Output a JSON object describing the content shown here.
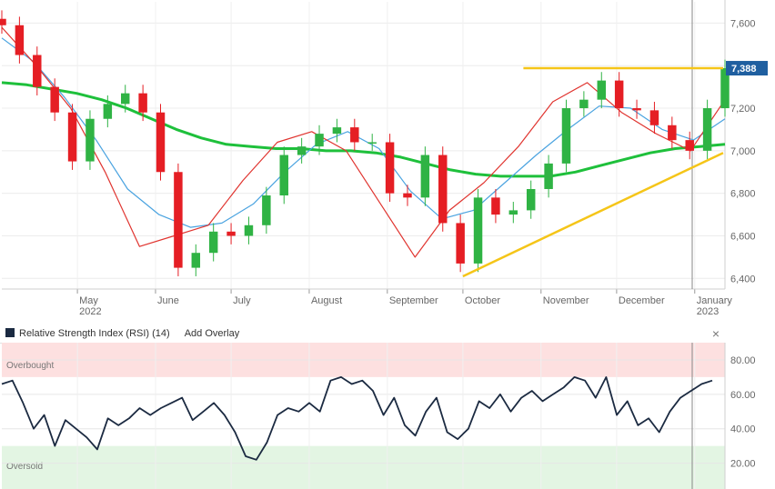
{
  "colors": {
    "up_candle": "#2fb344",
    "down_candle": "#e51e24",
    "sma_long": "#1ec03b",
    "sma_mid": "#4aa3e0",
    "ema_short": "#e0342f",
    "trendline": "#f5c518",
    "price_badge": "#1f5fa0",
    "rsi_line": "#1b2a41",
    "overbought_fill": "#fde0e0",
    "oversold_fill": "#e3f5e3"
  },
  "main_chart": {
    "y_ticks": [
      "7,600",
      "7,400",
      "7,200",
      "7,000",
      "6,800",
      "6,600",
      "6,400"
    ],
    "x_labels": [
      "May",
      "June",
      "July",
      "August",
      "September",
      "October",
      "November",
      "December",
      "January"
    ],
    "year_labels": [
      "2022",
      "2023"
    ],
    "last_price": "7,388"
  },
  "rsi_panel": {
    "title": "Relative Strength Index (RSI) (14)",
    "add_overlay": "Add Overlay",
    "close_glyph": "×",
    "overbought_label": "Overbought",
    "oversold_label": "Oversold",
    "y_ticks": [
      "80.00",
      "60.00",
      "40.00",
      "20.00"
    ]
  },
  "chart_data": [
    {
      "type": "candlestick",
      "title": "",
      "y_range": [
        6350,
        7700
      ],
      "x_range": [
        "2022-04-01",
        "2023-01-13"
      ],
      "grid": true,
      "last_price": 7388,
      "series": [
        {
          "name": "",
          "x": [
            "2022-04-01",
            "2022-04-08",
            "2022-04-15",
            "2022-04-22",
            "2022-04-29",
            "2022-05-06",
            "2022-05-13",
            "2022-05-20",
            "2022-05-27",
            "2022-06-03",
            "2022-06-10",
            "2022-06-17",
            "2022-06-24",
            "2022-07-01",
            "2022-07-08",
            "2022-07-15",
            "2022-07-22",
            "2022-07-29",
            "2022-08-05",
            "2022-08-12",
            "2022-08-19",
            "2022-08-26",
            "2022-09-02",
            "2022-09-09",
            "2022-09-16",
            "2022-09-23",
            "2022-09-30",
            "2022-10-07",
            "2022-10-14",
            "2022-10-21",
            "2022-10-28",
            "2022-11-04",
            "2022-11-11",
            "2022-11-18",
            "2022-11-25",
            "2022-12-02",
            "2022-12-09",
            "2022-12-16",
            "2022-12-23",
            "2022-12-30",
            "2023-01-06",
            "2023-01-13"
          ],
          "values": [
            7590,
            7450,
            7300,
            7180,
            6950,
            7150,
            7220,
            7270,
            7180,
            6900,
            6450,
            6520,
            6620,
            6600,
            6650,
            6790,
            6980,
            7020,
            7080,
            7110,
            7040,
            7040,
            6800,
            6780,
            6980,
            6660,
            6470,
            6780,
            6700,
            6720,
            6820,
            6940,
            7200,
            7240,
            7330,
            7200,
            7190,
            7120,
            7050,
            7000,
            7200,
            7388
          ]
        },
        {
          "name": "",
          "values": [
            7320,
            7310,
            7290,
            7270,
            7240,
            7200,
            7150,
            7100,
            7060,
            7030,
            7020,
            7010,
            7010,
            7000,
            7000,
            6990,
            6970,
            6940,
            6910,
            6890,
            6880,
            6880,
            6880,
            6900,
            6930,
            6960,
            6990,
            7010,
            7020,
            7030
          ]
        },
        {
          "name": "",
          "values": [
            7530,
            7420,
            7250,
            7050,
            6820,
            6700,
            6640,
            6660,
            6750,
            6900,
            7030,
            7090,
            7010,
            6810,
            6680,
            6720,
            6850,
            6980,
            7100,
            7210,
            7200,
            7100,
            7050,
            7150
          ]
        },
        {
          "name": "",
          "values": [
            7580,
            7400,
            7200,
            6900,
            6550,
            6600,
            6650,
            6860,
            7040,
            7090,
            7000,
            6750,
            6500,
            6720,
            6850,
            7020,
            7230,
            7320,
            7180,
            7080,
            7000,
            7240
          ]
        }
      ]
    },
    {
      "type": "line",
      "title": "",
      "y_range": [
        5,
        90
      ],
      "overbought": 70,
      "oversold": 30,
      "series": [
        {
          "name": "",
          "values": [
            66,
            68,
            55,
            40,
            48,
            30,
            45,
            40,
            35,
            28,
            46,
            42,
            46,
            52,
            48,
            52,
            55,
            58,
            45,
            50,
            55,
            48,
            38,
            24,
            22,
            32,
            48,
            52,
            50,
            55,
            50,
            68,
            70,
            66,
            68,
            62,
            48,
            58,
            42,
            36,
            50,
            58,
            38,
            34,
            40,
            56,
            52,
            60,
            50,
            58,
            62,
            56,
            60,
            64,
            70,
            68,
            58,
            70,
            48,
            56,
            42,
            46,
            38,
            50,
            58,
            62,
            66,
            68
          ]
        }
      ]
    }
  ]
}
